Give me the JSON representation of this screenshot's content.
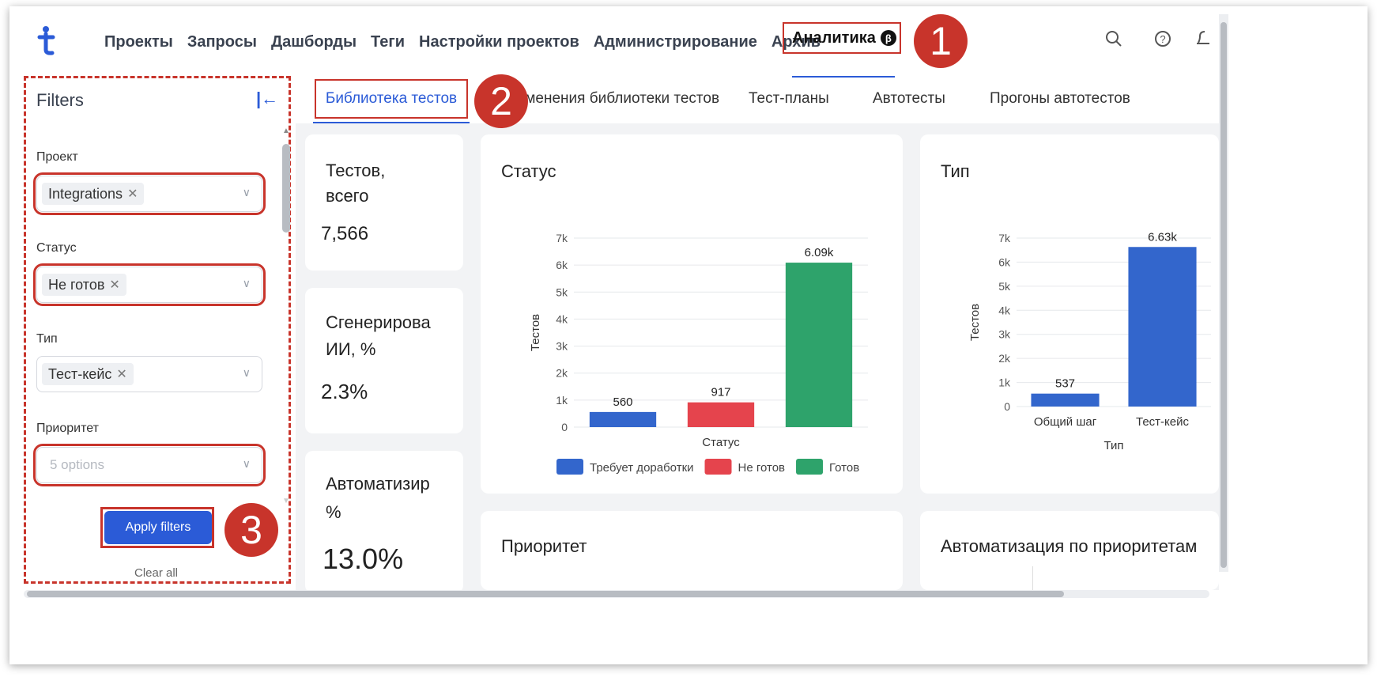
{
  "nav": {
    "items": [
      "Проекты",
      "Запросы",
      "Дашборды",
      "Теги",
      "Настройки проектов",
      "Администрирование",
      "Архив"
    ],
    "active": "Аналитика",
    "beta_badge": "β"
  },
  "markers": [
    "1",
    "2",
    "3"
  ],
  "icons": {
    "logo": "brand-logo-icon",
    "search": "search-icon",
    "help": "help-icon",
    "notifications": "bell-icon"
  },
  "filters": {
    "title": "Filters",
    "collapse_glyph": "|←",
    "project_label": "Проект",
    "project_value": "Integrations",
    "status_label": "Статус",
    "status_value": "Не готов",
    "type_label": "Тип",
    "type_value": "Тест-кейс",
    "priority_label": "Приоритет",
    "priority_placeholder": "5 options",
    "apply": "Apply filters",
    "clear": "Clear all"
  },
  "tabs": [
    "Библиотека тестов",
    "Изменения библиотеки тестов",
    "Тест-планы",
    "Автотесты",
    "Прогоны автотестов"
  ],
  "kpis": [
    {
      "title_line1": "Тестов,",
      "title_line2": "всего",
      "value": "7,566"
    },
    {
      "title_line1": "Сгенерирова",
      "title_line2": "ИИ, %",
      "value": "2.3%"
    },
    {
      "title_line1": "Автоматизир",
      "title_line2": "%",
      "value": "13.0%"
    }
  ],
  "charts": {
    "status_title": "Статус",
    "type_title": "Тип",
    "priority_title": "Приоритет",
    "automation_title": "Автоматизация по приоритетам"
  },
  "colors": {
    "accent": "#2b5bd7",
    "marker": "#c8342b",
    "bar_blue": "#3366cc",
    "bar_red": "#e5444d",
    "bar_green": "#2ea36b"
  },
  "chart_data": [
    {
      "type": "bar",
      "title": "Статус",
      "xlabel": "Статус",
      "ylabel": "Тестов",
      "categories": [
        "Требует доработки",
        "Не готов",
        "Готов"
      ],
      "values": [
        560,
        917,
        6090
      ],
      "value_labels": [
        "560",
        "917",
        "6.09k"
      ],
      "ylim": [
        0,
        7000
      ],
      "yticks": [
        "0",
        "1k",
        "2k",
        "3k",
        "4k",
        "5k",
        "6k",
        "7k"
      ],
      "legend": [
        "Требует доработки",
        "Не готов",
        "Готов"
      ],
      "legend_position": "bottom"
    },
    {
      "type": "bar",
      "title": "Тип",
      "xlabel": "Тип",
      "ylabel": "Тестов",
      "categories": [
        "Общий шаг",
        "Тест-кейс"
      ],
      "values": [
        537,
        6630
      ],
      "value_labels": [
        "537",
        "6.63k"
      ],
      "ylim": [
        0,
        7000
      ],
      "yticks": [
        "0",
        "1k",
        "2k",
        "3k",
        "4k",
        "5k",
        "6k",
        "7k"
      ]
    }
  ]
}
